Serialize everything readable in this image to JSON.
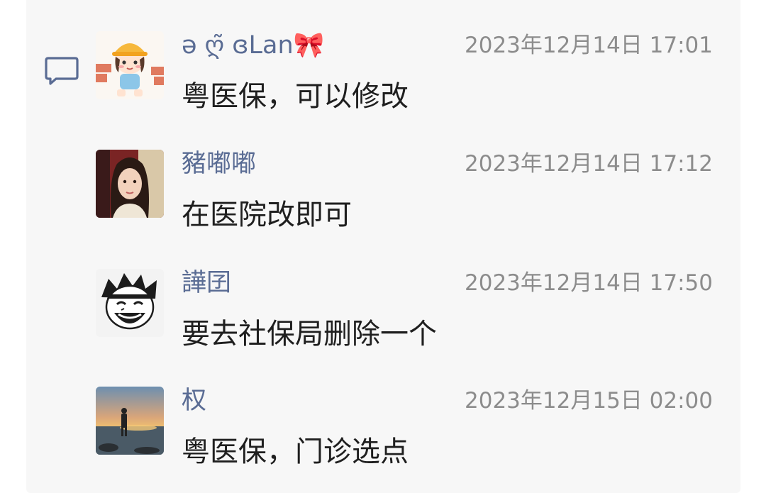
{
  "comments": [
    {
      "name": "ə ღ̃ ɞLan",
      "name_suffix": "🎀",
      "time": "2023年12月14日 17:01",
      "text": "粤医保，可以修改",
      "avatar_icon": "cartoon-girl-hardhat-avatar"
    },
    {
      "name": "豬嘟嘟",
      "time": "2023年12月14日 17:12",
      "text": "在医院改即可",
      "avatar_icon": "woman-photo-avatar"
    },
    {
      "name": "譁囝",
      "time": "2023年12月14日 17:50",
      "text": "要去社保局删除一个",
      "avatar_icon": "manga-laughing-boy-avatar"
    },
    {
      "name": "权",
      "time": "2023年12月15日 02:00",
      "text": "粤医保，门诊选点",
      "avatar_icon": "sunset-beach-avatar"
    }
  ],
  "colors": {
    "name": "#5a6c94",
    "time": "#8c8c8c",
    "text": "#1f1f1f",
    "panel_bg": "#f7f7f7",
    "comment_icon": "#5a6c94"
  },
  "icons": {
    "comment": "comment-bubble-icon"
  }
}
